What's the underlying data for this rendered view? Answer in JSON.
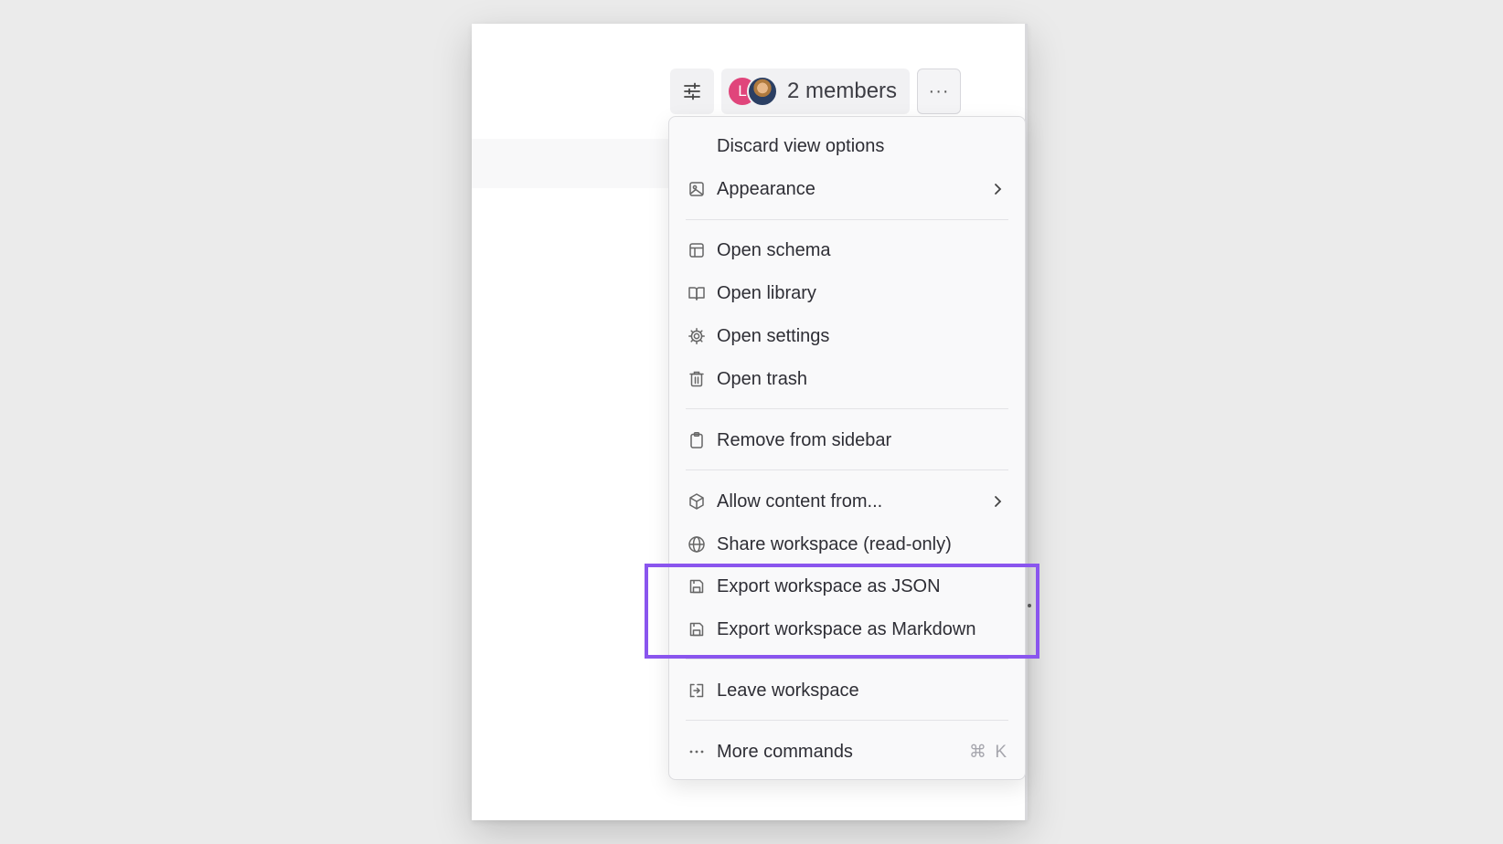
{
  "toolbar": {
    "members_label": "2 members",
    "avatar_initial": "L",
    "more_label": "···"
  },
  "menu": {
    "items": [
      {
        "label": "Discard view options",
        "icon": "none"
      },
      {
        "label": "Appearance",
        "icon": "image-icon",
        "submenu": true
      },
      {
        "label": "Open schema",
        "icon": "layout-icon"
      },
      {
        "label": "Open library",
        "icon": "book-icon"
      },
      {
        "label": "Open settings",
        "icon": "gear-icon"
      },
      {
        "label": "Open trash",
        "icon": "trash-icon"
      },
      {
        "label": "Remove from sidebar",
        "icon": "clipboard-icon"
      },
      {
        "label": "Allow content from...",
        "icon": "cube-icon",
        "submenu": true
      },
      {
        "label": "Share workspace (read-only)",
        "icon": "globe-icon"
      },
      {
        "label": "Export workspace as JSON",
        "icon": "save-icon"
      },
      {
        "label": "Export workspace as Markdown",
        "icon": "save-icon"
      },
      {
        "label": "Leave workspace",
        "icon": "exit-icon"
      },
      {
        "label": "More commands",
        "icon": "ellipsis-icon",
        "shortcut": "⌘ K"
      }
    ]
  },
  "colors": {
    "highlight": "#8a55ee",
    "avatar_initial_bg": "#e0457b"
  }
}
